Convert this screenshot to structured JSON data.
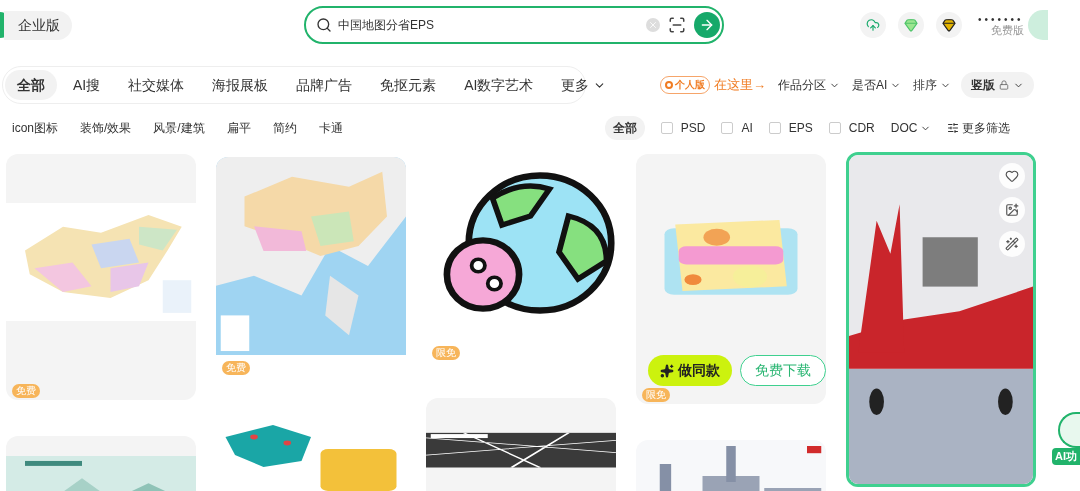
{
  "header": {
    "enterprise_label": "企业版",
    "search": {
      "value": "中国地图分省EPS"
    },
    "account_name": "•••••••",
    "account_plan": "免费版"
  },
  "category_tabs": [
    {
      "label": "全部",
      "selected": true
    },
    {
      "label": "AI搜",
      "selected": false
    },
    {
      "label": "社交媒体",
      "selected": false
    },
    {
      "label": "海报展板",
      "selected": false
    },
    {
      "label": "品牌广告",
      "selected": false
    },
    {
      "label": "免抠元素",
      "selected": false
    },
    {
      "label": "AI数字艺术",
      "selected": false
    },
    {
      "label": "更多",
      "selected": false
    }
  ],
  "promo": {
    "badge": "个人版",
    "link": "在这里→"
  },
  "sort_menus": [
    {
      "label": "作品分区"
    },
    {
      "label": "是否AI"
    },
    {
      "label": "排序"
    }
  ],
  "orientation": {
    "label": "竖版"
  },
  "style_tags": [
    "icon图标",
    "装饰/效果",
    "风景/建筑",
    "扁平",
    "简约",
    "卡通"
  ],
  "format_filters": [
    {
      "kind": "pill",
      "label": "全部",
      "selected": true
    },
    {
      "kind": "checkbox",
      "label": "PSD",
      "checked": false
    },
    {
      "kind": "checkbox",
      "label": "AI",
      "checked": false
    },
    {
      "kind": "checkbox",
      "label": "EPS",
      "checked": false
    },
    {
      "kind": "checkbox",
      "label": "CDR",
      "checked": false
    },
    {
      "kind": "dropdown",
      "label": "DOC"
    }
  ],
  "more_filters": "更多筛选",
  "columns": [
    [
      {
        "kind": "tile",
        "badge": "免费"
      },
      {
        "kind": "tile"
      }
    ],
    [
      {
        "kind": "plain",
        "badge": "免费"
      },
      {
        "kind": "plain"
      }
    ],
    [
      {
        "kind": "plain",
        "badge": "限免"
      },
      {
        "kind": "tile"
      }
    ],
    [
      {
        "kind": "tile",
        "badge": "限免",
        "actions": [
          "做同款",
          "免费下载"
        ]
      },
      {
        "kind": "plain"
      }
    ],
    [
      {
        "kind": "plain",
        "highlighted": true
      }
    ]
  ],
  "ai_button": {
    "label": "AI功"
  }
}
